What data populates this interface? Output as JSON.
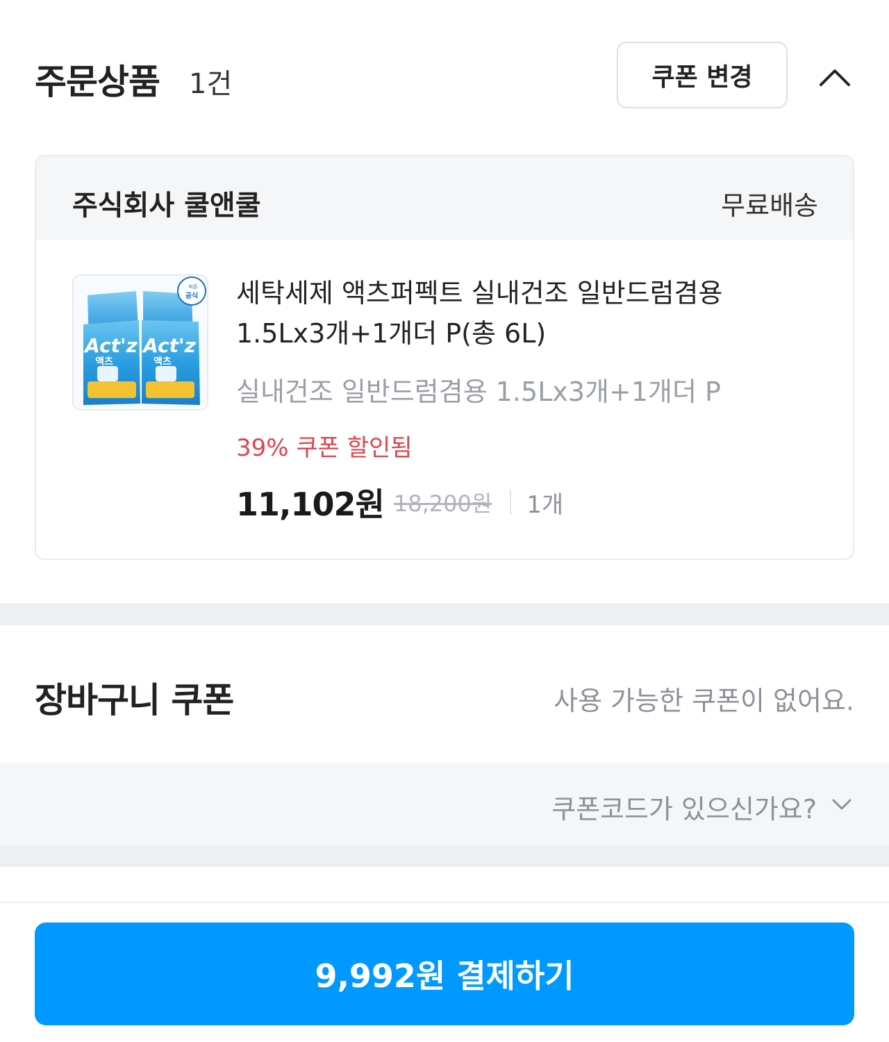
{
  "order": {
    "title": "주문상품",
    "count": "1건",
    "coupon_change_label": "쿠폰 변경",
    "toggle_icon": "chevron-up-icon"
  },
  "seller": {
    "name": "주식회사 쿨앤쿨",
    "shipping": "무료배송"
  },
  "product": {
    "name_line1": "세탁세제 액츠퍼펙트 실내건조 일반드럼겸용",
    "name_line2": "1.5Lx3개+1개더 P(총 6L)",
    "option": "실내건조 일반드럼겸용 1.5Lx3개+1개더 P",
    "discount": "39% 쿠폰 할인됨",
    "sale_price": "11,102원",
    "original_price": "18,200원",
    "quantity": "1개",
    "thumb_brand": "Act'z",
    "thumb_sub": "액츠",
    "thumb_badge": "공식",
    "thumb_badge_brand": "피죤"
  },
  "cart_coupon": {
    "title": "장바구니 쿠폰",
    "status": "사용 가능한 쿠폰이 없어요.",
    "code_prompt": "쿠폰코드가 있으신가요?",
    "code_icon": "chevron-down-icon"
  },
  "payment": {
    "button_label": "9,992원 결제하기"
  },
  "colors": {
    "accent": "#0099ff",
    "discount": "#e0434b",
    "muted": "#8c9198",
    "section_bg": "#f5f6f8"
  }
}
